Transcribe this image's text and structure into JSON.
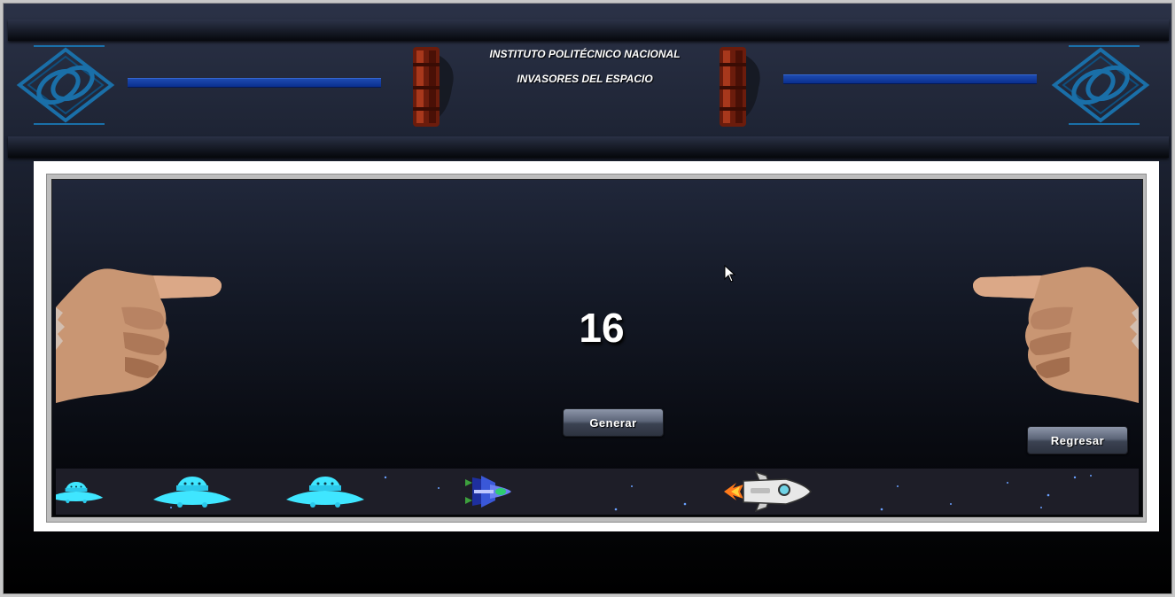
{
  "header": {
    "institution": "INSTITUTO POLITÉCNICO NACIONAL",
    "subtitle": "INVASORES DEL ESPACIO",
    "logo_icon": "ipn-logo-icon",
    "pillar_icon": "ipn-pillar-icon"
  },
  "game": {
    "generated_number": "16",
    "generate_button": "Generar",
    "back_button": "Regresar",
    "left_hand_icon": "pointing-hand-right-icon",
    "right_hand_icon": "pointing-hand-left-icon",
    "strip_sprites": [
      "ufo-icon",
      "ufo-icon",
      "ufo-icon",
      "spaceship-icon",
      "rocket-icon"
    ]
  },
  "colors": {
    "accent_blue": "#1d4ab0",
    "ufo_cyan": "#3fe6ff",
    "button_gray": "#5c6578"
  }
}
